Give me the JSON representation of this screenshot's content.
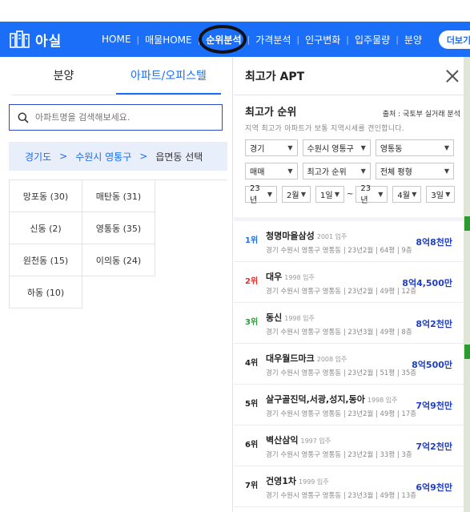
{
  "nav": {
    "logo_text": "아실",
    "items": [
      "HOME",
      "매물HOME",
      "순위분석",
      "가격분석",
      "인구변화",
      "입주물량",
      "분양"
    ],
    "active": "순위분석",
    "more": "더보기"
  },
  "left": {
    "tabs": [
      "분양",
      "아파트/오피스텔"
    ],
    "active_tab": "아파트/오피스텔",
    "search_placeholder": "아파트명을 검색해보세요.",
    "breadcrumb": [
      "경기도",
      "수원시 영통구",
      "읍면동 선택"
    ],
    "dongs": [
      "망포동 (30)",
      "매탄동 (31)",
      "신동 (2)",
      "영통동 (35)",
      "원천동 (15)",
      "이의동 (24)",
      "하동 (10)"
    ]
  },
  "right": {
    "title": "최고가 APT",
    "section_title": "최고가 순위",
    "source": "출처 : 국토부 실거래 분석",
    "desc": "지역 최고가 아파트가 보통 지역시세를 견인합니다.",
    "filters_row1": [
      "경기",
      "수원시 영통구",
      "영통동"
    ],
    "filters_row2": [
      "매매",
      "최고가 순위",
      "전체 평형"
    ],
    "filters_row3": [
      "23년",
      "2월",
      "1일",
      "23년",
      "4월",
      "3일"
    ],
    "tilde": "~",
    "ranks": [
      {
        "rank": "1위",
        "rank_color": "#1a6ef7",
        "name": "청명마을삼성",
        "year": "2001 입주",
        "info": "경기 수원시 영통구 영통동 | 23년2월 | 64평 | 9층",
        "price": "8억8천만"
      },
      {
        "rank": "2위",
        "rank_color": "#e0312f",
        "name": "대우",
        "year": "1998 입주",
        "info": "경기 수원시 영통구 영통동 | 23년2월 | 49평 | 12층",
        "price": "8억4,500만"
      },
      {
        "rank": "3위",
        "rank_color": "#2e9c3a",
        "name": "동신",
        "year": "1998 입주",
        "info": "경기 수원시 영통구 영통동 | 23년3월 | 49평 | 8층",
        "price": "8억2천만"
      },
      {
        "rank": "4위",
        "rank_color": "#222222",
        "name": "대우월드마크",
        "year": "2008 입주",
        "info": "경기 수원시 영통구 영통동 | 23년2월 | 51평 | 35층",
        "price": "8억500만"
      },
      {
        "rank": "5위",
        "rank_color": "#222222",
        "name": "살구골진덕,서광,성지,동아",
        "year": "1998 입주",
        "info": "경기 수원시 영통구 영통동 | 23년2월 | 49평 | 17층",
        "price": "7억9천만"
      },
      {
        "rank": "6위",
        "rank_color": "#222222",
        "name": "벽산삼익",
        "year": "1997 입주",
        "info": "경기 수원시 영통구 영통동 | 23년2월 | 33평 | 3층",
        "price": "7억2천만"
      },
      {
        "rank": "7위",
        "rank_color": "#222222",
        "name": "건영1차",
        "year": "1999 입주",
        "info": "경기 수원시 영통구 영통동 | 23년3월 | 49평 | 13층",
        "price": "6억9천만"
      }
    ]
  }
}
